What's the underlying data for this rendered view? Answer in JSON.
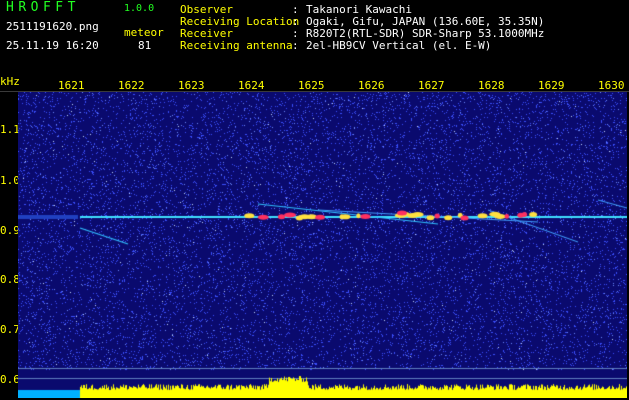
{
  "header": {
    "app_title": "HROFFT",
    "app_version": "1.0.0",
    "file_name": "2511191620.png",
    "datetime": "25.11.19 16:20",
    "type_label": "meteor",
    "count_value": "81"
  },
  "info": [
    {
      "label": "Observer",
      "value": "Takanori Kawachi"
    },
    {
      "label": "Receiving Location",
      "value": "Ogaki, Gifu, JAPAN (136.60E, 35.35N)"
    },
    {
      "label": "Receiver",
      "value": "R820T2(RTL-SDR) SDR-Sharp 53.1000MHz"
    },
    {
      "label": "Receiving antenna",
      "value": "2el-HB9CV Vertical (el. E-W)"
    }
  ],
  "axes": {
    "freq_unit": "kHz",
    "x_ticks": [
      "1621",
      "1622",
      "1623",
      "1624",
      "1625",
      "1626",
      "1627",
      "1628",
      "1629",
      "1630"
    ],
    "y_ticks": [
      "1.1",
      "1.0",
      "0.9",
      "0.8",
      "0.7",
      "0.6"
    ]
  },
  "colors": {
    "background": "#000000",
    "spectrogram_bg": "#0a0a6e",
    "noise": "#3c50ff",
    "carrier": "#40e0ff",
    "meteor_hot": "#ff3060",
    "meteor_warm": "#ffe040",
    "level_bar": "#ffff00",
    "level_base": "#00b0ff",
    "label_green": "#22ff22",
    "label_yellow": "#ffff00"
  }
}
